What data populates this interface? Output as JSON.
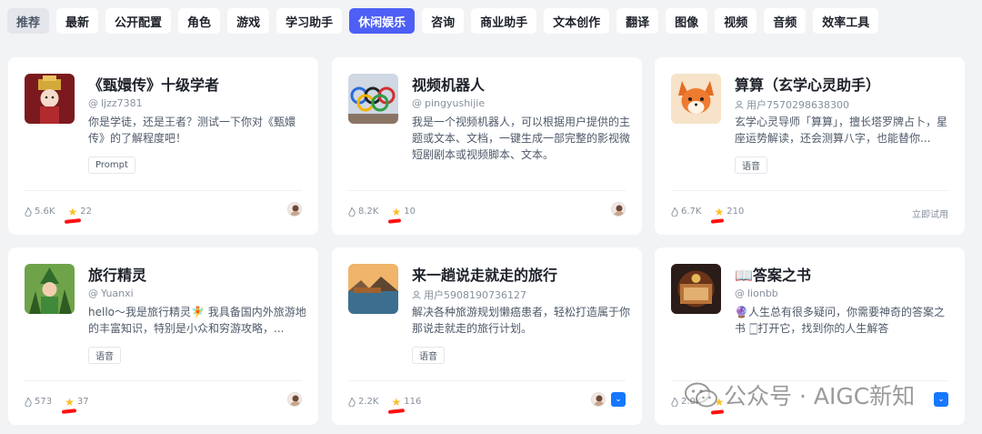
{
  "tabs": [
    {
      "label": "推荐",
      "state": "selected-gray"
    },
    {
      "label": "最新"
    },
    {
      "label": "公开配置"
    },
    {
      "label": "角色"
    },
    {
      "label": "游戏"
    },
    {
      "label": "学习助手"
    },
    {
      "label": "休闲娱乐",
      "state": "active"
    },
    {
      "label": "咨询"
    },
    {
      "label": "商业助手"
    },
    {
      "label": "文本创作"
    },
    {
      "label": "翻译"
    },
    {
      "label": "图像"
    },
    {
      "label": "视频"
    },
    {
      "label": "音频"
    },
    {
      "label": "效率工具"
    }
  ],
  "cards": [
    {
      "title": "《甄嬛传》十级学者",
      "author": "ljzz7381",
      "author_prefix": "@",
      "description": "你是学徒，还是王者？测试一下你对《甄嬛传》的了解程度吧！",
      "tag": "Prompt",
      "views": "5.6K",
      "stars": "22"
    },
    {
      "title": "视频机器人",
      "author": "pingyushijie",
      "author_prefix": "@",
      "description": "我是一个视频机器人，可以根据用户提供的主题或文本、文档，一键生成一部完整的影视微短剧剧本或视频脚本、文本。",
      "views": "8.2K",
      "stars": "10"
    },
    {
      "title": "算算（玄学心灵助手）",
      "author": "用户7570298638300",
      "author_prefix": "@",
      "description": "玄学心灵导师「算算」，擅长塔罗牌占卜，星座运势解读，还会测算八字，也能替你...",
      "tag": "语音",
      "views": "6.7K",
      "stars": "210",
      "action": "立即试用"
    },
    {
      "title": "旅行精灵",
      "author": "Yuanxi",
      "author_prefix": "@",
      "description": "hello～我是旅行精灵🧚 我具备国内外旅游地的丰富知识，特别是小众和穷游攻略，...",
      "tag": "语音",
      "views": "573",
      "stars": "37"
    },
    {
      "title": "来一趟说走就走的旅行",
      "author": "用户5908190736127",
      "author_prefix": "@",
      "description": "解决各种旅游规划懒癌患者，轻松打造属于你那说走就走的旅行计划。",
      "tag": "语音",
      "views": "2.2K",
      "stars": "116"
    },
    {
      "title": "📖答案之书",
      "author": "lionbb",
      "author_prefix": "@",
      "description": "🔮人生总有很多疑问，你需要神奇的答案之书 🀆打开它，找到你的人生解答",
      "views": "2.0K",
      "stars": ""
    }
  ],
  "watermark": "公众号 · AIGC新知",
  "colors": {
    "accent": "#4d5ff5",
    "star": "#fbbf24",
    "mark": "#ff1010"
  }
}
